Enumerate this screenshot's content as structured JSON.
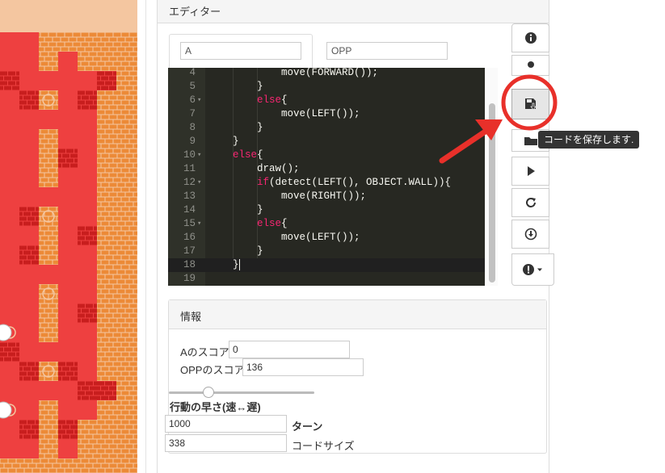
{
  "editor": {
    "title": "エディター",
    "player_a_name": "A",
    "player_opp_name": "OPP",
    "code_lines": [
      {
        "num": "4",
        "fold": "",
        "active": false,
        "indent": 3,
        "parts": [
          {
            "t": "move(FORWARD());",
            "k": false
          }
        ]
      },
      {
        "num": "5",
        "fold": "",
        "active": false,
        "indent": 2,
        "parts": [
          {
            "t": "}",
            "k": false
          }
        ]
      },
      {
        "num": "6",
        "fold": "▾",
        "active": false,
        "indent": 2,
        "parts": [
          {
            "t": "else",
            "k": true
          },
          {
            "t": "{",
            "k": false
          }
        ]
      },
      {
        "num": "7",
        "fold": "",
        "active": false,
        "indent": 3,
        "parts": [
          {
            "t": "move(LEFT());",
            "k": false
          }
        ]
      },
      {
        "num": "8",
        "fold": "",
        "active": false,
        "indent": 2,
        "parts": [
          {
            "t": "}",
            "k": false
          }
        ]
      },
      {
        "num": "9",
        "fold": "",
        "active": false,
        "indent": 1,
        "parts": [
          {
            "t": "}",
            "k": false
          }
        ]
      },
      {
        "num": "10",
        "fold": "▾",
        "active": false,
        "indent": 1,
        "parts": [
          {
            "t": "else",
            "k": true
          },
          {
            "t": "{",
            "k": false
          }
        ]
      },
      {
        "num": "11",
        "fold": "",
        "active": false,
        "indent": 2,
        "parts": [
          {
            "t": "draw();",
            "k": false
          }
        ]
      },
      {
        "num": "12",
        "fold": "▾",
        "active": false,
        "indent": 2,
        "parts": [
          {
            "t": "if",
            "k": true
          },
          {
            "t": "(detect(LEFT(), OBJECT.WALL)){",
            "k": false
          }
        ]
      },
      {
        "num": "13",
        "fold": "",
        "active": false,
        "indent": 3,
        "parts": [
          {
            "t": "move(RIGHT());",
            "k": false
          }
        ]
      },
      {
        "num": "14",
        "fold": "",
        "active": false,
        "indent": 2,
        "parts": [
          {
            "t": "}",
            "k": false
          }
        ]
      },
      {
        "num": "15",
        "fold": "▾",
        "active": false,
        "indent": 2,
        "parts": [
          {
            "t": "else",
            "k": true
          },
          {
            "t": "{",
            "k": false
          }
        ]
      },
      {
        "num": "16",
        "fold": "",
        "active": false,
        "indent": 3,
        "parts": [
          {
            "t": "move(LEFT());",
            "k": false
          }
        ]
      },
      {
        "num": "17",
        "fold": "",
        "active": false,
        "indent": 2,
        "parts": [
          {
            "t": "}",
            "k": false
          }
        ]
      },
      {
        "num": "18",
        "fold": "",
        "active": true,
        "indent": 1,
        "parts": [
          {
            "t": "}",
            "k": false
          }
        ],
        "caret": true
      },
      {
        "num": "19",
        "fold": "",
        "active": false,
        "indent": 0,
        "parts": []
      }
    ]
  },
  "info": {
    "title": "情報",
    "score_a_label": "Aのスコア",
    "score_a_value": "0",
    "score_opp_label": "OPPのスコア",
    "score_opp_value": "136",
    "speed_label": "行動の早さ(速↔遅)",
    "turns_value": "1000",
    "turns_label": "ターン",
    "code_size_value": "338",
    "code_size_label": "コードサイズ",
    "speed_level": 0.27
  },
  "toolbar": {
    "buttons": [
      "info-icon",
      "person-icon",
      "save-icon",
      "folder-icon",
      "play-icon",
      "refresh-icon",
      "download-icon",
      "alert-dropdown-icon"
    ],
    "save_tooltip": "コードを保存します."
  },
  "colors": {
    "accent_red": "#e8302a",
    "editor_bg": "#272822",
    "keyword": "#f92672"
  }
}
